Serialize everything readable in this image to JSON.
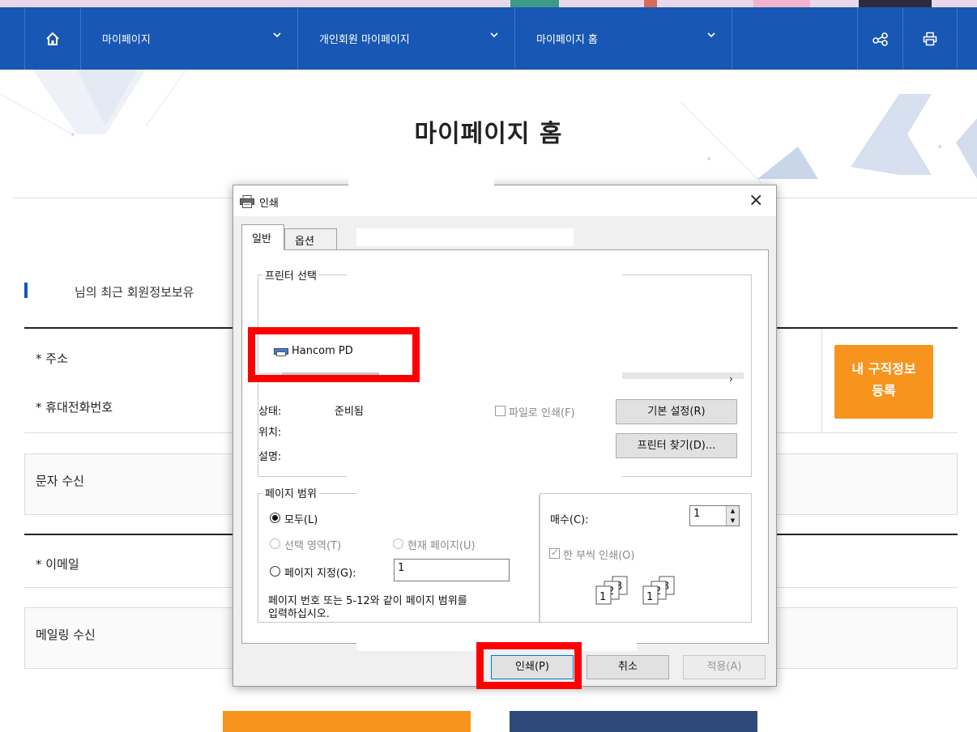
{
  "nav": {
    "home_icon": "home-icon",
    "menu1": "마이페이지",
    "menu2": "개인회원 마이페이지",
    "menu3": "마이페이지 홈",
    "share_icon": "share-icon",
    "print_icon": "print-icon",
    "bg_color": "#1857b3"
  },
  "page": {
    "title": "마이페이지 홈",
    "section_text": "님의 최근 회원정보보유",
    "rows": {
      "address": "* 주소",
      "phone": "* 휴대전화번호",
      "sms": "문자 수신",
      "email": "* 이메일",
      "mailing": "메일링 수신"
    },
    "register_button": [
      "내 구직정보",
      "등록"
    ],
    "accent_color": "#f7941d"
  },
  "dialog": {
    "title": "인쇄",
    "close": "×",
    "tabs": [
      "일반",
      "옵션"
    ],
    "printer_group": "프린터 선택",
    "printer_name": "Hancom PD",
    "status_label": "상태:",
    "status_value": "준비됨",
    "location_label": "위치:",
    "comment_label": "설명:",
    "print_to_file": "파일로 인쇄(F)",
    "preferences_button": "기본 설정(R)",
    "find_printer_button": "프린터 찾기(D)...",
    "page_range_group": "페이지 범위",
    "range_all": "모두(L)",
    "range_selection": "선택 영역(T)",
    "range_current": "현재 페이지(U)",
    "range_pages": "페이지 지정(G):",
    "pages_value": "1",
    "range_hint": "페이지 번호 또는 5-12와 같이 페이지 범위를",
    "range_hint2": "입력하십시오.",
    "copies_label": "매수(C):",
    "copies_value": "1",
    "collate": "한 부씩 인쇄(O)",
    "print_button": "인쇄(P)",
    "cancel_button": "취소",
    "apply_button": "적용(A)"
  }
}
